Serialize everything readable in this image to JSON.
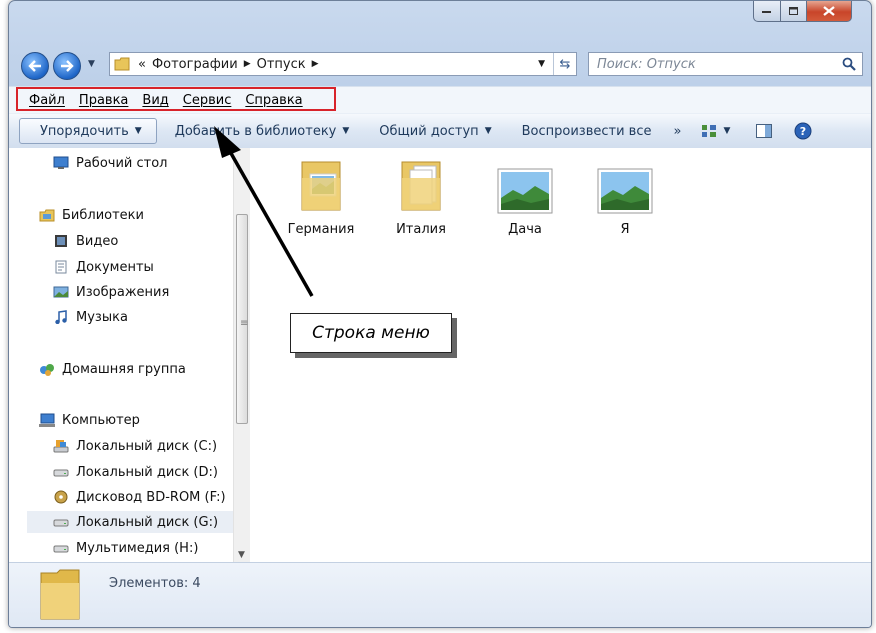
{
  "window": {
    "controls": {
      "minimize": "minimize-icon",
      "maximize": "maximize-icon",
      "close": "close-icon"
    }
  },
  "address_bar": {
    "prefix": "«",
    "crumbs": [
      "Фотографии",
      "Отпуск"
    ],
    "search_placeholder": "Поиск: Отпуск"
  },
  "menu_bar": {
    "items": [
      "Файл",
      "Правка",
      "Вид",
      "Сервис",
      "Справка"
    ]
  },
  "toolbar": {
    "organize": "Упорядочить",
    "add_to_library": "Добавить в библиотеку",
    "share": "Общий доступ",
    "play_all": "Воспроизвести все",
    "more": "»"
  },
  "nav": {
    "desktop": "Рабочий стол",
    "libraries": "Библиотеки",
    "video": "Видео",
    "documents": "Документы",
    "images": "Изображения",
    "music": "Музыка",
    "homegroup": "Домашняя группа",
    "computer": "Компьютер",
    "disk_c": "Локальный диск (C:)",
    "disk_d": "Локальный диск (D:)",
    "bd_rom": "Дисковод BD-ROM (F:)",
    "disk_g": "Локальный диск (G:)",
    "multimedia": "Мультимедия (H:)"
  },
  "files": [
    {
      "name": "Германия",
      "type": "folder"
    },
    {
      "name": "Италия",
      "type": "folder"
    },
    {
      "name": "Дача",
      "type": "image"
    },
    {
      "name": "Я",
      "type": "image"
    }
  ],
  "status_bar": {
    "count_text": "Элементов: 4"
  },
  "annotation": {
    "callout": "Строка меню"
  },
  "colors": {
    "highlight_border": "#d8232a",
    "toolbar_text": "#1e395b",
    "close_button": "#c8452a"
  }
}
